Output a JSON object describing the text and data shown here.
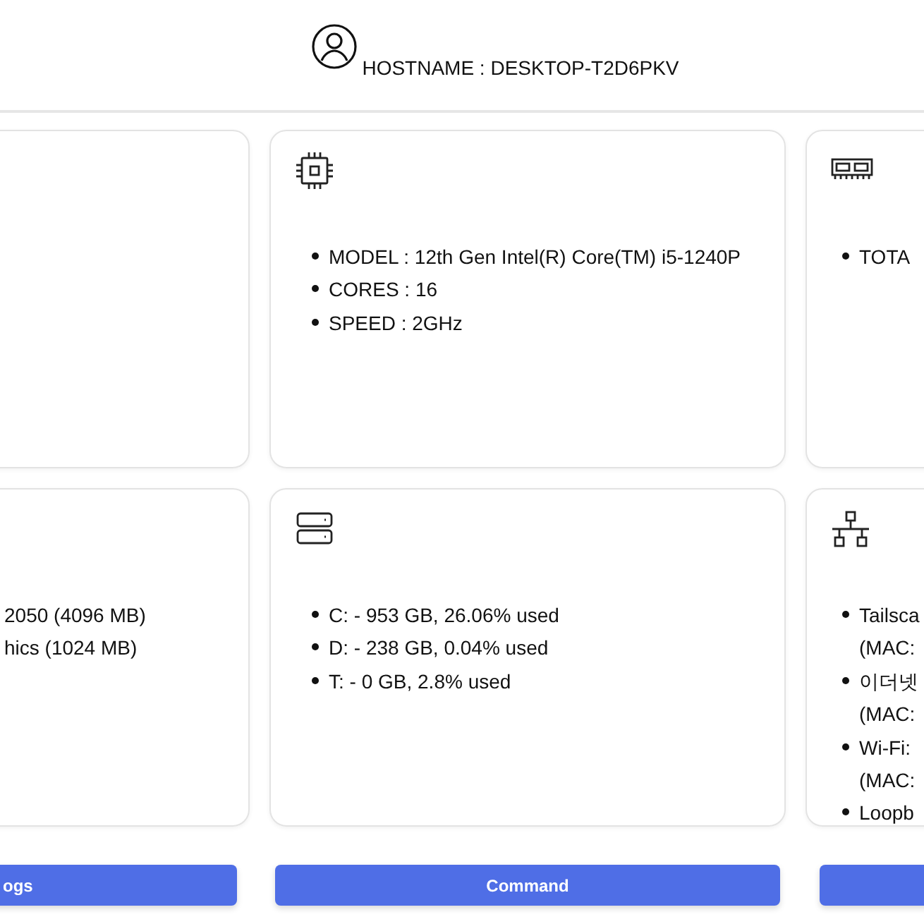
{
  "header": {
    "hostname": "HOSTNAME : DESKTOP-T2D6PKV"
  },
  "cards": [
    {
      "kind": "clipped"
    },
    {
      "kind": "cpu",
      "items": [
        {
          "lines": [
            "MODEL : 12th Gen Intel(R) Core(TM) i5-1240P"
          ]
        },
        {
          "lines": [
            "CORES : 16"
          ]
        },
        {
          "lines": [
            "SPEED : 2GHz"
          ]
        }
      ]
    },
    {
      "kind": "memory",
      "items": [
        {
          "lines": [
            "TOTA"
          ]
        }
      ]
    },
    {
      "kind": "clipped",
      "items": [
        {
          "lines": [
            "2050 (4096 MB)"
          ]
        },
        {
          "lines": [
            "hics (1024 MB)"
          ]
        }
      ]
    },
    {
      "kind": "storage",
      "items": [
        {
          "lines": [
            "C: - 953 GB, 26.06% used"
          ]
        },
        {
          "lines": [
            "D: - 238 GB, 0.04% used"
          ]
        },
        {
          "lines": [
            "T: - 0 GB, 2.8% used"
          ]
        }
      ]
    },
    {
      "kind": "network",
      "items": [
        {
          "lines": [
            "Tailsca",
            "(MAC:"
          ]
        },
        {
          "lines": [
            "이더넷",
            "(MAC:"
          ]
        },
        {
          "lines": [
            "Wi-Fi:",
            "(MAC:"
          ]
        },
        {
          "lines": [
            "Loopb"
          ]
        }
      ]
    }
  ],
  "buttons": [
    {
      "kind": "text",
      "label": "ogs"
    },
    {
      "kind": "text",
      "label": "Command"
    },
    {
      "kind": "blank"
    }
  ]
}
